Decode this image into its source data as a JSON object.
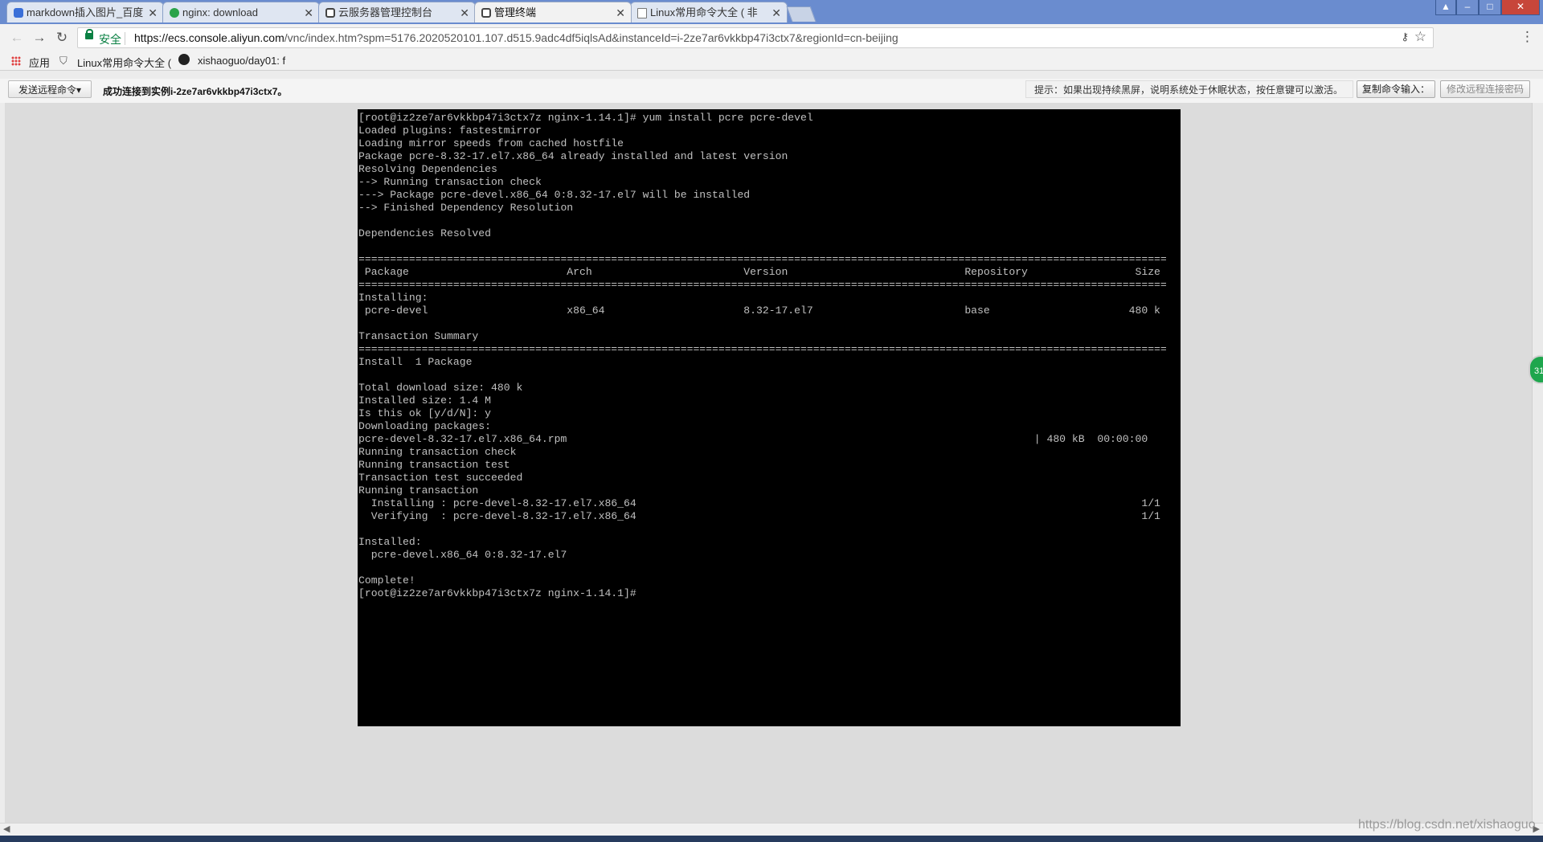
{
  "tabs": [
    {
      "label": "markdown插入图片_百度",
      "favicon": "baidu-paw-icon",
      "active": false
    },
    {
      "label": "nginx: download",
      "favicon": "nginx-icon",
      "active": false
    },
    {
      "label": "云服务器管理控制台",
      "favicon": "aliyun-icon",
      "active": false
    },
    {
      "label": "管理终端",
      "favicon": "aliyun-icon",
      "active": true
    },
    {
      "label": "Linux常用命令大全 ( 非",
      "favicon": "document-icon",
      "active": false
    }
  ],
  "toolbar": {
    "secure_label": "安全",
    "url_host": "https://ecs.console.aliyun.com",
    "url_path": "/vnc/index.htm?spm=5176.2020520101.107.d515.9adc4df5iqlsAd&instanceId=i-2ze7ar6vkkbp47i3ctx7&regionId=cn-beijing"
  },
  "bookmarks": {
    "apps_label": "应用",
    "items": [
      {
        "label": "Linux常用命令大全 (",
        "icon": "document-icon"
      },
      {
        "label": "xishaoguo/day01: f",
        "icon": "github-icon"
      }
    ]
  },
  "vnc": {
    "send_command_label": "发送远程命令▾",
    "status_text": "成功连接到实例i-2ze7ar6vkkbp47i3ctx7。",
    "hint_text": "提示：如果出现持续黑屏，说明系统处于休眠状态，按任意键可以激活。",
    "copy_input_label": "复制命令输入：",
    "change_password_label": "修改远程连接密码"
  },
  "terminal": {
    "lines": [
      "[root@iz2ze7ar6vkkbp47i3ctx7z nginx-1.14.1]# yum install pcre pcre-devel",
      "Loaded plugins: fastestmirror",
      "Loading mirror speeds from cached hostfile",
      "Package pcre-8.32-17.el7.x86_64 already installed and latest version",
      "Resolving Dependencies",
      "--> Running transaction check",
      "---> Package pcre-devel.x86_64 0:8.32-17.el7 will be installed",
      "--> Finished Dependency Resolution",
      "",
      "Dependencies Resolved",
      "",
      "================================================================================================================================",
      " Package                         Arch                        Version                            Repository                 Size",
      "================================================================================================================================",
      "Installing:",
      " pcre-devel                      x86_64                      8.32-17.el7                        base                      480 k",
      "",
      "Transaction Summary",
      "================================================================================================================================",
      "Install  1 Package",
      "",
      "Total download size: 480 k",
      "Installed size: 1.4 M",
      "Is this ok [y/d/N]: y",
      "Downloading packages:",
      "pcre-devel-8.32-17.el7.x86_64.rpm                                                                          | 480 kB  00:00:00",
      "Running transaction check",
      "Running transaction test",
      "Transaction test succeeded",
      "Running transaction",
      "  Installing : pcre-devel-8.32-17.el7.x86_64                                                                                1/1",
      "  Verifying  : pcre-devel-8.32-17.el7.x86_64                                                                                1/1",
      "",
      "Installed:",
      "  pcre-devel.x86_64 0:8.32-17.el7",
      "",
      "Complete!",
      "[root@iz2ze7ar6vkkbp47i3ctx7z nginx-1.14.1]#"
    ]
  },
  "side_badge": "31",
  "watermark": "https://blog.csdn.net/xishaoguo"
}
